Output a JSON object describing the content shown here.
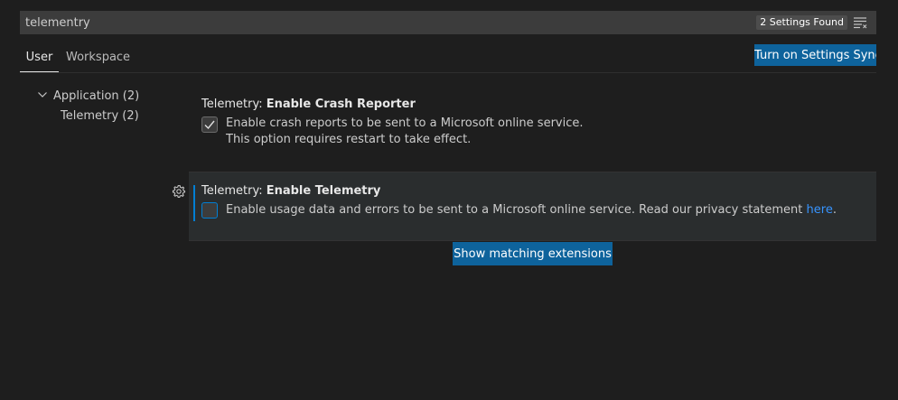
{
  "search": {
    "value": "telementry",
    "result_count": "2 Settings Found"
  },
  "tabs": [
    {
      "label": "User",
      "active": true
    },
    {
      "label": "Workspace",
      "active": false
    }
  ],
  "sync_button_label": "Turn on Settings Sync",
  "tree": {
    "application": "Application (2)",
    "telemetry": "Telemetry (2)"
  },
  "settings": [
    {
      "category": "Telemetry: ",
      "name": "Enable Crash Reporter",
      "checked": true,
      "description_line1": "Enable crash reports to be sent to a Microsoft online service.",
      "description_line2": "This option requires restart to take effect."
    },
    {
      "category": "Telemetry: ",
      "name": "Enable Telemetry",
      "checked": false,
      "description": "Enable usage data and errors to be sent to a Microsoft online service. Read our privacy statement ",
      "link_text": "here",
      "description_end": "."
    }
  ],
  "extensions_button_label": "Show matching extensions",
  "colors": {
    "background": "#1e1e1e",
    "accent_button": "#0e639c",
    "link": "#3794ff",
    "focus": "#007fd4"
  },
  "icons": {
    "filter": "filter-icon",
    "chevron": "chevron-down-icon",
    "gear": "gear-icon",
    "check": "check-icon"
  }
}
